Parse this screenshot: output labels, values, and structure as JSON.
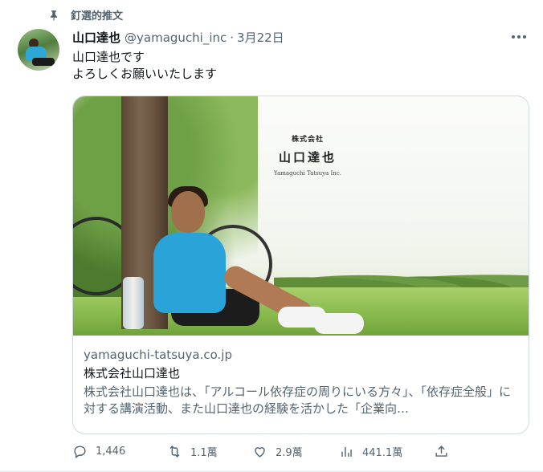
{
  "pinned": {
    "label": "釘選的推文",
    "icon": "pin-icon"
  },
  "tweet": {
    "author_name": "山口達也",
    "handle": "@yamaguchi_inc",
    "separator": "·",
    "date": "3月22日",
    "text_line1": "山口達也です",
    "text_line2": "よろしくお願いいたします"
  },
  "card": {
    "logo_small": "株式会社",
    "logo_name": "山口達也",
    "logo_en": "Yamaguchi Tatsuya Inc.",
    "domain": "yamaguchi-tatsuya.co.jp",
    "title": "株式会社山口達也",
    "description": "株式会社山口達也は、「アルコール依存症の周りにいる方々」、「依存症全般」に対する講演活動、また山口達也の経験を活かした「企業向…"
  },
  "actions": {
    "replies": "1,446",
    "retweets": "1.1萬",
    "likes": "2.9萬",
    "views": "441.1萬"
  },
  "colors": {
    "text_primary": "#0f1419",
    "text_secondary": "#536471",
    "border": "#cfd9de"
  }
}
